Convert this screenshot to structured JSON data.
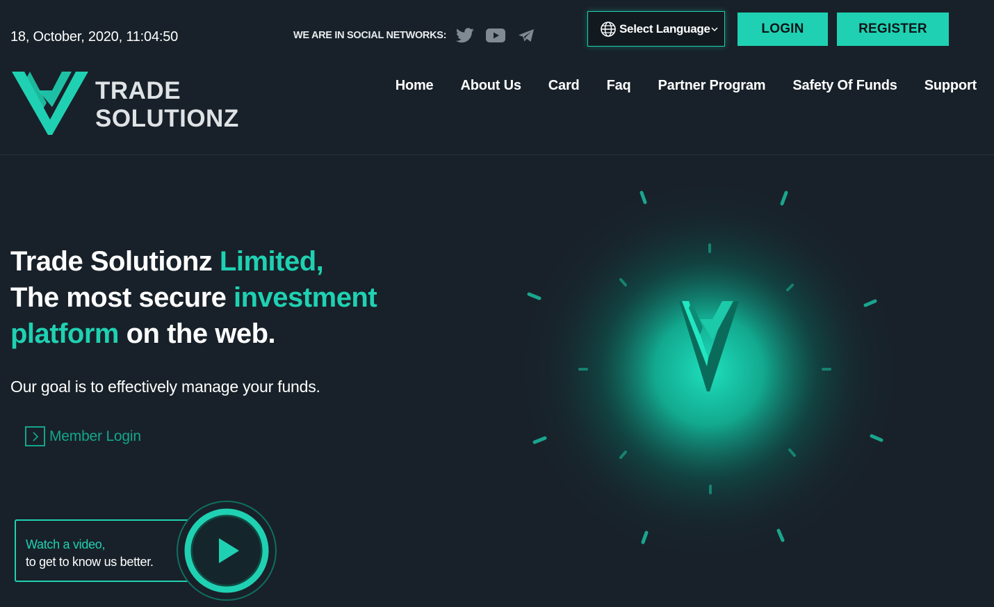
{
  "header": {
    "datetime": "18, October, 2020, 11:04:50",
    "social_label": "WE ARE IN SOCIAL NETWORKS:",
    "social_icons": [
      "twitter-icon",
      "youtube-icon",
      "telegram-icon"
    ],
    "language_select": "Select Language",
    "login_label": "LOGIN",
    "register_label": "REGISTER"
  },
  "logo": {
    "line1": "TRADE",
    "line2": "SOLUTIONZ"
  },
  "nav": {
    "items": [
      "Home",
      "About Us",
      "Card",
      "Faq",
      "Partner Program",
      "Safety Of Funds",
      "Support"
    ]
  },
  "hero": {
    "title_part1": "Trade Solutionz ",
    "title_accent1": "Limited,",
    "title_part2": "The most secure ",
    "title_accent2": "investment",
    "title_accent3": "platform",
    "title_part3": " on the web.",
    "subtitle": "Our goal is to effectively manage your funds.",
    "member_login": "Member Login"
  },
  "video": {
    "line1": "Watch a video,",
    "line2": "to get to know us better."
  },
  "colors": {
    "accent": "#1fd1b2",
    "background": "#182129",
    "text": "#ffffff",
    "muted_accent": "#14a58c"
  }
}
